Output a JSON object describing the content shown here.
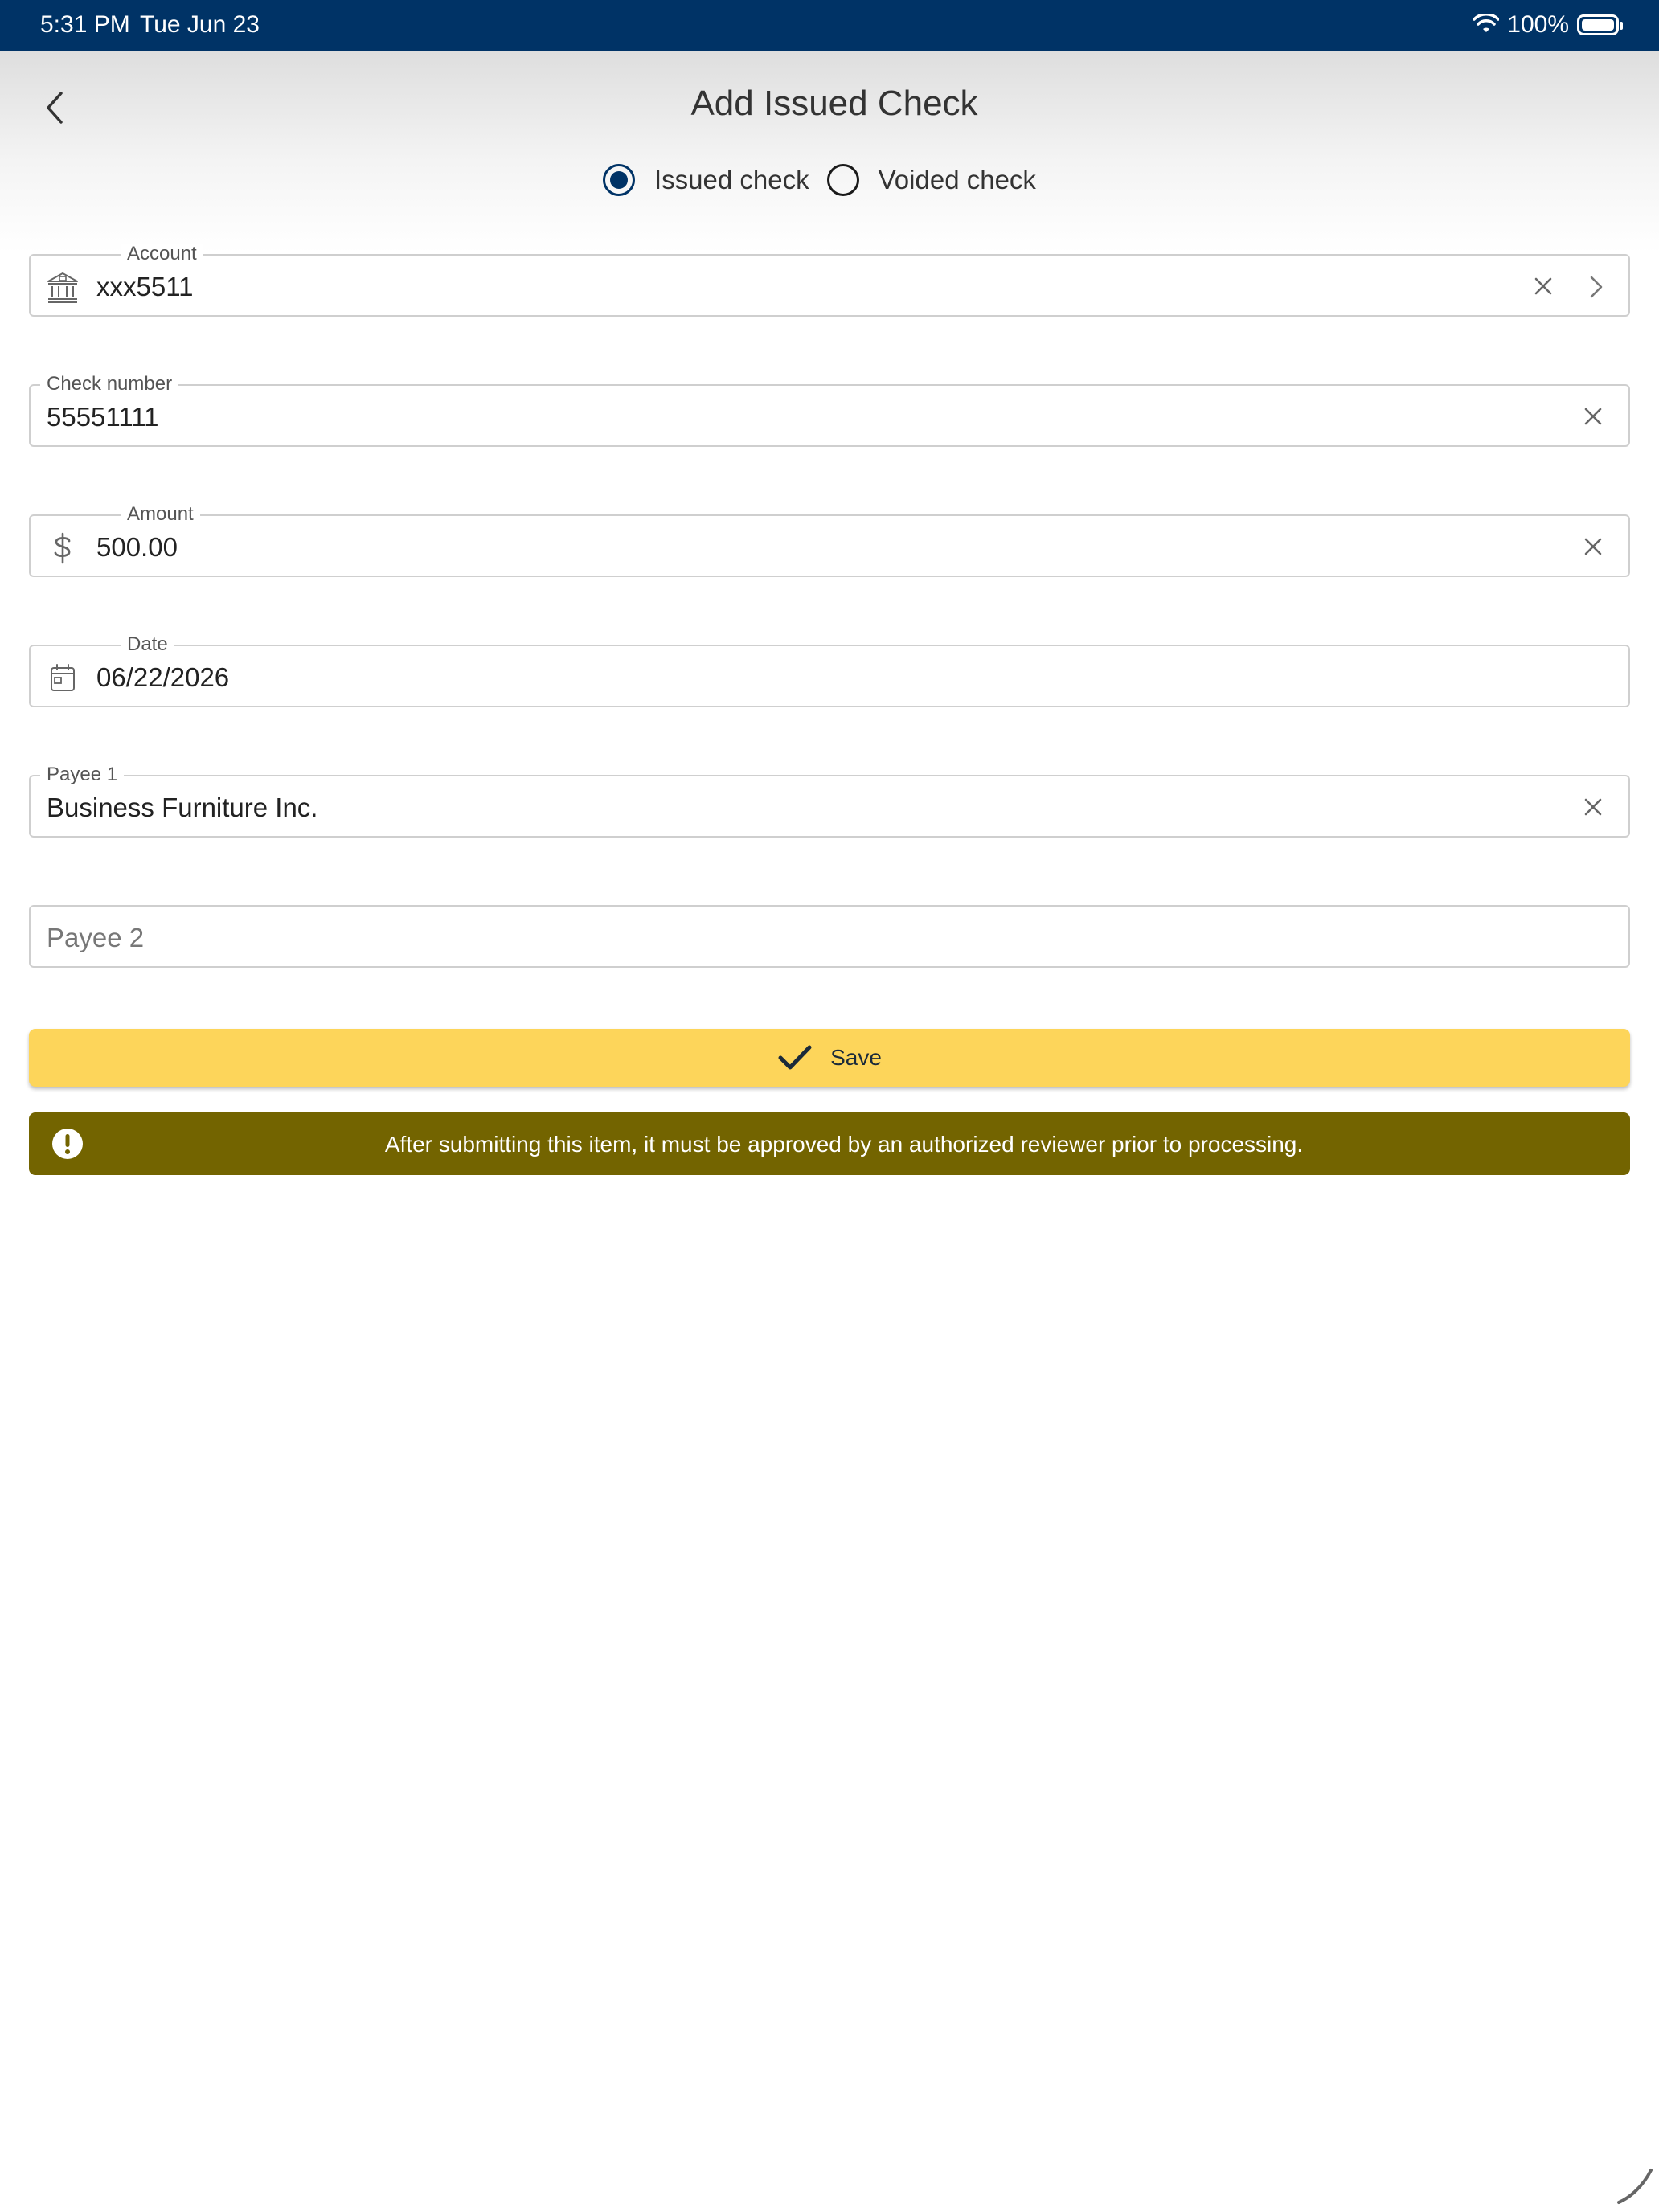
{
  "status_bar": {
    "time": "5:31 PM",
    "date": "Tue Jun 23",
    "battery": "100%",
    "wifi_icon": "wifi-icon",
    "battery_icon": "battery-icon"
  },
  "header": {
    "title": "Add Issued Check",
    "back_icon": "chevron-left-icon"
  },
  "check_type": {
    "options": [
      {
        "label": "Issued check",
        "selected": true
      },
      {
        "label": "Voided check",
        "selected": false
      }
    ]
  },
  "form": {
    "account": {
      "label": "Account",
      "value": "xxx5511",
      "icon": "bank-icon"
    },
    "check_number": {
      "label": "Check number",
      "value": "55551111"
    },
    "amount": {
      "label": "Amount",
      "value": "500.00",
      "icon": "dollar-icon"
    },
    "date": {
      "label": "Date",
      "value": "06/22/2026",
      "icon": "calendar-icon"
    },
    "payee1": {
      "label": "Payee 1",
      "value": "Business Furniture Inc."
    },
    "payee2": {
      "placeholder": "Payee 2",
      "value": ""
    }
  },
  "save_button": {
    "label": "Save",
    "icon": "check-icon"
  },
  "notice": {
    "text": "After submitting this item, it must be approved by an authorized reviewer prior to processing.",
    "icon": "exclamation-icon"
  },
  "colors": {
    "status_bar": "#003366",
    "radio_accent": "#003366",
    "save_button": "#fdd55a",
    "notice_background": "#736400"
  }
}
